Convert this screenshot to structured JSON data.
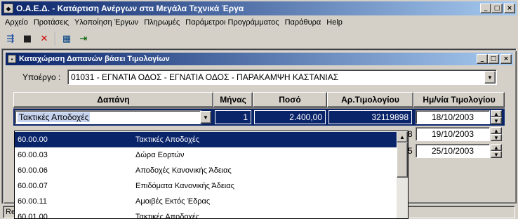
{
  "window": {
    "title": "Ο.Α.Ε.Δ. - Κατάρτιση Ανέργων στα Μεγάλα Τεχνικά Έργα",
    "min": "_",
    "max": "□",
    "close": "×"
  },
  "menu": [
    "Αρχείο",
    "Προτάσεις",
    "Υλοποίηση Έργων",
    "Πληρωμές",
    "Παράμετροι Προγράμματος",
    "Παράθυρα",
    "Help"
  ],
  "toolbar": {
    "icons": [
      "new-record-icon",
      "save-icon",
      "delete-icon",
      "grid-icon",
      "exit-icon"
    ],
    "glyphs": [
      "⇶",
      "■",
      "✕",
      "▦",
      "⇥"
    ]
  },
  "child": {
    "title": "Καταχώριση Δαπανών βάσει Τιμολογίων",
    "min": "_",
    "max": "□",
    "close": "×"
  },
  "subproject": {
    "label": "Υποέργο :",
    "value": "01031 - ΕΓΝΑΤΙΑ ΟΔΟΣ - ΕΓΝΑΤΙΑ ΟΔΟΣ - ΠΑΡΑΚΑΜΨΗ ΚΑΣΤΑΝΙΑΣ"
  },
  "grid": {
    "headers": [
      "Δαπάνη",
      "Μήνας",
      "Ποσό",
      "Αρ.Τιμολογίου",
      "Ημ/νία Τιμολογίου"
    ],
    "row1": {
      "dapani": "Τακτικές Αποδοχές",
      "minas": "1",
      "poso": "2.400,00",
      "ar": "32119898",
      "date": "18/10/2003"
    },
    "row2": {
      "ar_tail": "8",
      "date": "19/10/2003"
    },
    "row3": {
      "ar_tail": "5",
      "date": "25/10/2003"
    }
  },
  "dropdown": {
    "items": [
      {
        "code": "60.00.00",
        "desc": "Τακτικές Αποδοχές"
      },
      {
        "code": "60.00.03",
        "desc": "Δώρα Εορτών"
      },
      {
        "code": "60.00.06",
        "desc": "Αποδοχές Κανονικής Άδειας"
      },
      {
        "code": "60.00.07",
        "desc": "Επιδόματα Κανονικής Άδειας"
      },
      {
        "code": "60.00.11",
        "desc": "Αμοιβές Εκτός Έδρας"
      },
      {
        "code": "60.01.00",
        "desc": "Τακτικές Αποδοχές"
      }
    ]
  },
  "status": {
    "text": "Rea"
  }
}
